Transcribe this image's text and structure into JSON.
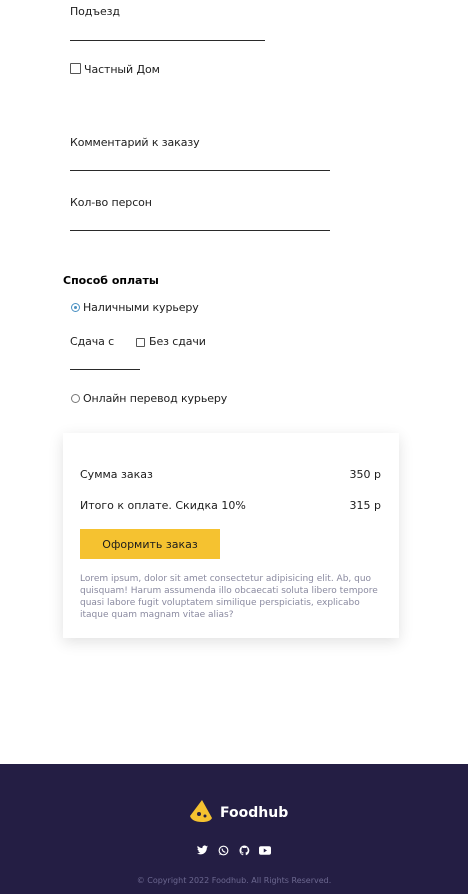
{
  "form": {
    "entrance_label": "Подъезд",
    "private_house_label": "Частный Дом",
    "comment_label": "Комментарий к заказу",
    "persons_label": "Кол-во персон"
  },
  "payment": {
    "title": "Способ оплаты",
    "cash_label": "Наличными курьеру",
    "change_label": "Сдача с",
    "no_change_label": "Без сдачи",
    "online_label": "Онлайн перевод курьеру",
    "selected": "cash"
  },
  "summary": {
    "order_sum_label": "Сумма заказ",
    "order_sum_value": "350 р",
    "total_label": "Итого к оплате. Скидка 10%",
    "total_value": "315 р",
    "submit_label": "Оформить заказ",
    "description": "Lorem ipsum, dolor sit amet consectetur adipisicing elit. Ab, quo quisquam! Harum assumenda illo obcaecati soluta libero tempore quasi labore fugit voluptatem similique perspiciatis, explicabo itaque quam magnam vitae alias?"
  },
  "footer": {
    "brand": "Foodhub",
    "socials": [
      "twitter-icon",
      "whatsapp-icon",
      "github-icon",
      "youtube-icon"
    ],
    "copyright": "© Copyright 2022 Foodhub. All Rights Reserved."
  },
  "colors": {
    "accent": "#f5c230",
    "footer_bg": "#241e44",
    "radio_active": "#4a90c2"
  }
}
